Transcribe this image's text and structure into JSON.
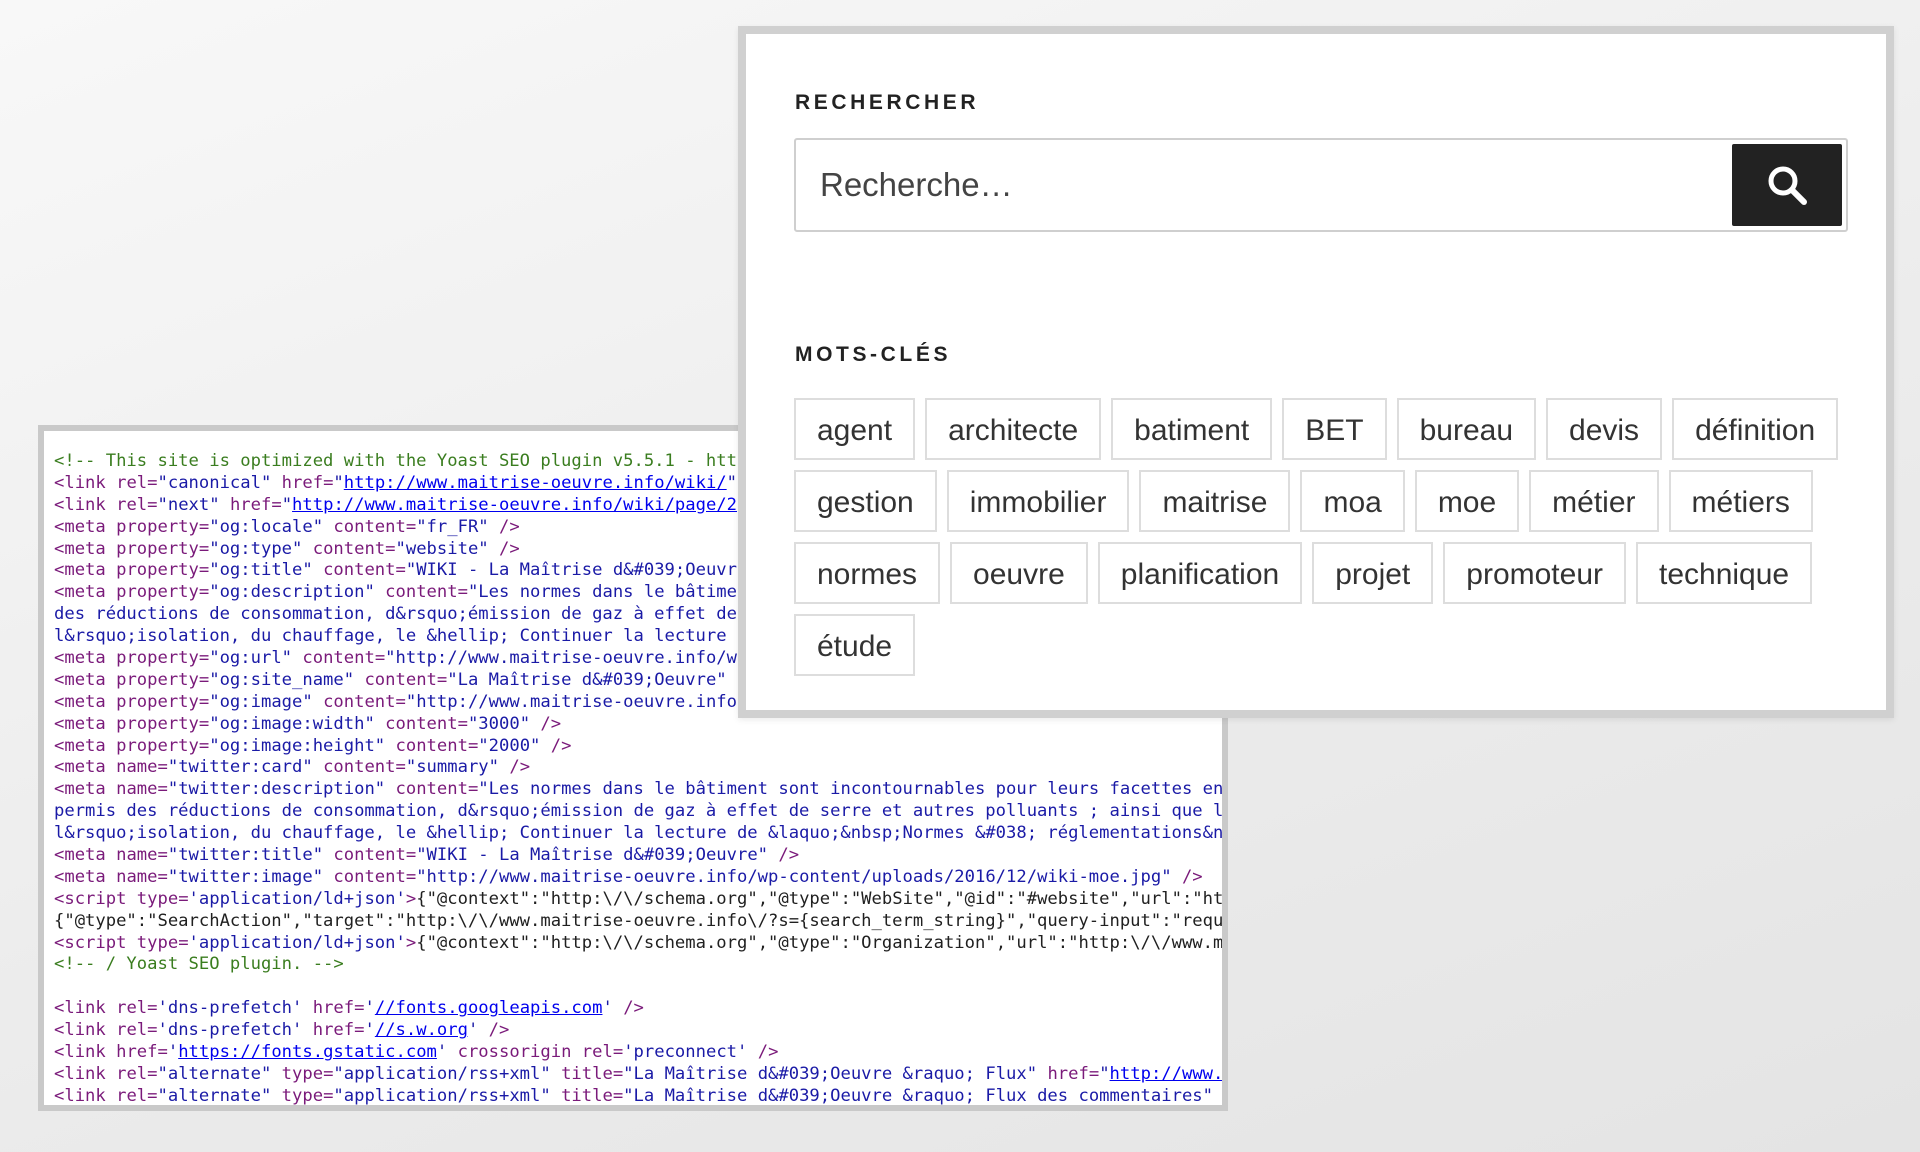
{
  "code_view": {
    "lines": [
      [
        [
          "c-comment",
          "<!-- This site is optimized with the Yoast SEO plugin v5.5.1 - htt"
        ]
      ],
      [
        [
          "c-tag",
          "<link "
        ],
        [
          "c-attr",
          "rel="
        ],
        [
          "c-val",
          "\"canonical\""
        ],
        [
          "c-attr",
          " href="
        ],
        [
          "c-val",
          "\""
        ],
        [
          "c-link",
          "http://www.maitrise-oeuvre.info/wiki/"
        ],
        [
          "c-val",
          "\""
        ]
      ],
      [
        [
          "c-tag",
          "<link "
        ],
        [
          "c-attr",
          "rel="
        ],
        [
          "c-val",
          "\"next\""
        ],
        [
          "c-attr",
          " href="
        ],
        [
          "c-val",
          "\""
        ],
        [
          "c-link",
          "http://www.maitrise-oeuvre.info/wiki/page/2"
        ]
      ],
      [
        [
          "c-tag",
          "<meta "
        ],
        [
          "c-attr",
          "property="
        ],
        [
          "c-val",
          "\"og:locale\""
        ],
        [
          "c-attr",
          " content="
        ],
        [
          "c-val",
          "\"fr_FR\""
        ],
        [
          "c-tag",
          " />"
        ]
      ],
      [
        [
          "c-tag",
          "<meta "
        ],
        [
          "c-attr",
          "property="
        ],
        [
          "c-val",
          "\"og:type\""
        ],
        [
          "c-attr",
          " content="
        ],
        [
          "c-val",
          "\"website\""
        ],
        [
          "c-tag",
          " />"
        ]
      ],
      [
        [
          "c-tag",
          "<meta "
        ],
        [
          "c-attr",
          "property="
        ],
        [
          "c-val",
          "\"og:title\""
        ],
        [
          "c-attr",
          " content="
        ],
        [
          "c-val",
          "\"WIKI - La Maîtrise d&#039;Oeuvr"
        ]
      ],
      [
        [
          "c-tag",
          "<meta "
        ],
        [
          "c-attr",
          "property="
        ],
        [
          "c-val",
          "\"og:description\""
        ],
        [
          "c-attr",
          " content="
        ],
        [
          "c-val",
          "\"Les normes dans le bâtime"
        ]
      ],
      [
        [
          "c-val",
          "des réductions de consommation, d&rsquo;émission de gaz à effet de"
        ]
      ],
      [
        [
          "c-val",
          "l&rsquo;isolation, du chauffage, le &hellip; Continuer la lecture"
        ]
      ],
      [
        [
          "c-tag",
          "<meta "
        ],
        [
          "c-attr",
          "property="
        ],
        [
          "c-val",
          "\"og:url\""
        ],
        [
          "c-attr",
          " content="
        ],
        [
          "c-val",
          "\"http://www.maitrise-oeuvre.info/w"
        ]
      ],
      [
        [
          "c-tag",
          "<meta "
        ],
        [
          "c-attr",
          "property="
        ],
        [
          "c-val",
          "\"og:site_name\""
        ],
        [
          "c-attr",
          " content="
        ],
        [
          "c-val",
          "\"La Maîtrise d&#039;Oeuvre\""
        ]
      ],
      [
        [
          "c-tag",
          "<meta "
        ],
        [
          "c-attr",
          "property="
        ],
        [
          "c-val",
          "\"og:image\""
        ],
        [
          "c-attr",
          " content="
        ],
        [
          "c-val",
          "\"http://www.maitrise-oeuvre.info"
        ]
      ],
      [
        [
          "c-tag",
          "<meta "
        ],
        [
          "c-attr",
          "property="
        ],
        [
          "c-val",
          "\"og:image:width\""
        ],
        [
          "c-attr",
          " content="
        ],
        [
          "c-val",
          "\"3000\""
        ],
        [
          "c-tag",
          " />"
        ]
      ],
      [
        [
          "c-tag",
          "<meta "
        ],
        [
          "c-attr",
          "property="
        ],
        [
          "c-val",
          "\"og:image:height\""
        ],
        [
          "c-attr",
          " content="
        ],
        [
          "c-val",
          "\"2000\""
        ],
        [
          "c-tag",
          " />"
        ]
      ],
      [
        [
          "c-tag",
          "<meta "
        ],
        [
          "c-attr",
          "name="
        ],
        [
          "c-val",
          "\"twitter:card\""
        ],
        [
          "c-attr",
          " content="
        ],
        [
          "c-val",
          "\"summary\""
        ],
        [
          "c-tag",
          " />"
        ]
      ],
      [
        [
          "c-tag",
          "<meta "
        ],
        [
          "c-attr",
          "name="
        ],
        [
          "c-val",
          "\"twitter:description\""
        ],
        [
          "c-attr",
          " content="
        ],
        [
          "c-val",
          "\"Les normes dans le bâtiment sont incontournables pour leurs facettes env"
        ]
      ],
      [
        [
          "c-val",
          "permis des réductions de consommation, d&rsquo;émission de gaz à effet de serre et autres polluants ; ainsi que l&"
        ]
      ],
      [
        [
          "c-val",
          "l&rsquo;isolation, du chauffage, le &hellip; Continuer la lecture de &laquo;&nbsp;Normes &#038; réglementations&nb"
        ]
      ],
      [
        [
          "c-tag",
          "<meta "
        ],
        [
          "c-attr",
          "name="
        ],
        [
          "c-val",
          "\"twitter:title\""
        ],
        [
          "c-attr",
          " content="
        ],
        [
          "c-val",
          "\"WIKI - La Maîtrise d&#039;Oeuvre\""
        ],
        [
          "c-tag",
          " />"
        ]
      ],
      [
        [
          "c-tag",
          "<meta "
        ],
        [
          "c-attr",
          "name="
        ],
        [
          "c-val",
          "\"twitter:image\""
        ],
        [
          "c-attr",
          " content="
        ],
        [
          "c-val",
          "\"http://www.maitrise-oeuvre.info/wp-content/uploads/2016/12/wiki-moe.jpg\""
        ],
        [
          "c-tag",
          " />"
        ]
      ],
      [
        [
          "c-tag",
          "<script "
        ],
        [
          "c-attr",
          "type="
        ],
        [
          "c-val",
          "'application/ld+json'"
        ],
        [
          "c-tag",
          ">"
        ],
        [
          "c-text",
          "{\"@context\":\"http:\\/\\/schema.org\",\"@type\":\"WebSite\",\"@id\":\"#website\",\"url\":\"htt"
        ]
      ],
      [
        [
          "c-text",
          "{\"@type\":\"SearchAction\",\"target\":\"http:\\/\\/www.maitrise-oeuvre.info\\/?s={search_term_string}\",\"query-input\":\"requi"
        ]
      ],
      [
        [
          "c-tag",
          "<script "
        ],
        [
          "c-attr",
          "type="
        ],
        [
          "c-val",
          "'application/ld+json'"
        ],
        [
          "c-tag",
          ">"
        ],
        [
          "c-text",
          "{\"@context\":\"http:\\/\\/schema.org\",\"@type\":\"Organization\",\"url\":\"http:\\/\\/www.ma"
        ]
      ],
      [
        [
          "c-comment",
          "<!-- / Yoast SEO plugin. -->"
        ]
      ],
      [],
      [
        [
          "c-tag",
          "<link "
        ],
        [
          "c-attr",
          "rel="
        ],
        [
          "c-val",
          "'dns-prefetch'"
        ],
        [
          "c-attr",
          " href="
        ],
        [
          "c-val",
          "'"
        ],
        [
          "c-link",
          "//fonts.googleapis.com"
        ],
        [
          "c-val",
          "'"
        ],
        [
          "c-tag",
          " />"
        ]
      ],
      [
        [
          "c-tag",
          "<link "
        ],
        [
          "c-attr",
          "rel="
        ],
        [
          "c-val",
          "'dns-prefetch'"
        ],
        [
          "c-attr",
          " href="
        ],
        [
          "c-val",
          "'"
        ],
        [
          "c-link",
          "//s.w.org"
        ],
        [
          "c-val",
          "'"
        ],
        [
          "c-tag",
          " />"
        ]
      ],
      [
        [
          "c-tag",
          "<link "
        ],
        [
          "c-attr",
          "href="
        ],
        [
          "c-val",
          "'"
        ],
        [
          "c-link",
          "https://fonts.gstatic.com"
        ],
        [
          "c-val",
          "'"
        ],
        [
          "c-attr",
          " crossorigin rel="
        ],
        [
          "c-val",
          "'preconnect'"
        ],
        [
          "c-tag",
          " />"
        ]
      ],
      [
        [
          "c-tag",
          "<link "
        ],
        [
          "c-attr",
          "rel="
        ],
        [
          "c-val",
          "\"alternate\""
        ],
        [
          "c-attr",
          " type="
        ],
        [
          "c-val",
          "\"application/rss+xml\""
        ],
        [
          "c-attr",
          " title="
        ],
        [
          "c-val",
          "\"La Maîtrise d&#039;Oeuvre &raquo; Flux\""
        ],
        [
          "c-attr",
          " href="
        ],
        [
          "c-val",
          "\""
        ],
        [
          "c-link",
          "http://www.m"
        ]
      ],
      [
        [
          "c-tag",
          "<link "
        ],
        [
          "c-attr",
          "rel="
        ],
        [
          "c-val",
          "\"alternate\""
        ],
        [
          "c-attr",
          " type="
        ],
        [
          "c-val",
          "\"application/rss+xml\""
        ],
        [
          "c-attr",
          " title="
        ],
        [
          "c-val",
          "\"La Maîtrise d&#039;Oeuvre &raquo; Flux des commentaires\""
        ],
        [
          "c-attr",
          " h"
        ]
      ]
    ]
  },
  "widget": {
    "search_title": "RECHERCHER",
    "search_placeholder": "Recherche…",
    "search_button_icon": "search-icon",
    "tags_title": "MOTS-CLÉS",
    "tags": [
      "agent",
      "architecte",
      "batiment",
      "BET",
      "bureau",
      "devis",
      "définition",
      "gestion",
      "immobilier",
      "maitrise",
      "moa",
      "moe",
      "métier",
      "métiers",
      "normes",
      "oeuvre",
      "planification",
      "projet",
      "promoteur",
      "technique",
      "étude"
    ]
  }
}
